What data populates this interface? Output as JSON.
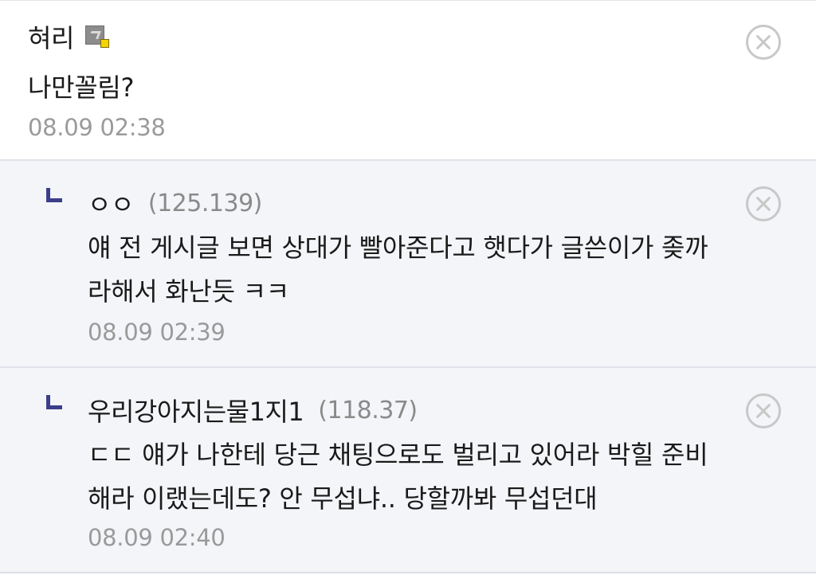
{
  "comments": [
    {
      "nickname": "혀리",
      "ip": "",
      "has_grade_icon": true,
      "text_lines": [
        "나만꼴림?"
      ],
      "date": "08.09 02:38"
    },
    {
      "nickname": "ㅇㅇ",
      "ip": "(125.139)",
      "text_lines": [
        "얘 전 게시글 보면 상대가 빨아준다고 햇다가 글쓴이가 좆까",
        "라해서 화난듯 ㅋㅋ"
      ],
      "date": "08.09 02:39"
    },
    {
      "nickname": "우리강아지는물1지1",
      "ip": "(118.37)",
      "text_lines": [
        "ㄷㄷ 얘가 나한테 당근 채팅으로도 벌리고 있어라 박힐 준비",
        "해라 이랬는데도? 안 무섭냐.. 당할까봐 무섭던대"
      ],
      "date": "08.09 02:40"
    }
  ],
  "icons": {
    "reply": "reply-arrow-icon",
    "delete": "close-circle-icon",
    "grade": "gallery-grade-icon"
  },
  "colors": {
    "reply_icon": "#3b3f8a",
    "reply_background": "#f4f5f8",
    "meta_text": "#9a9a9a",
    "delete_icon": "#c8c8c8"
  }
}
